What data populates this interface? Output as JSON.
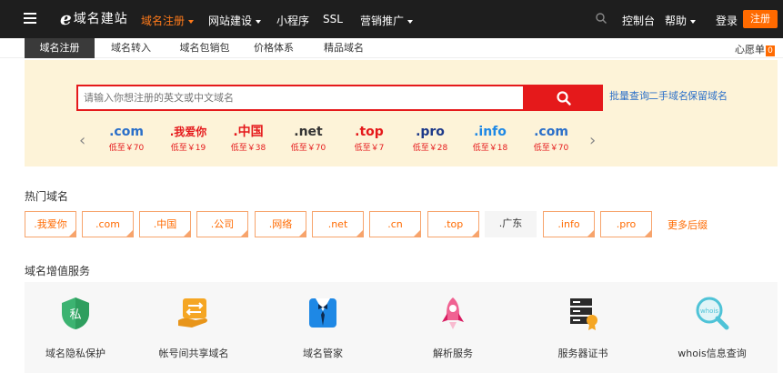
{
  "topnav": {
    "logo_text": "域名建站",
    "items": [
      {
        "label": "域名注册"
      },
      {
        "label": "网站建设"
      },
      {
        "label": "小程序"
      },
      {
        "label": "SSL"
      },
      {
        "label": "营销推广"
      }
    ],
    "console": "控制台",
    "help": "帮助",
    "login": "登录",
    "register": "注册",
    "colors": {
      "bg": "#1e1e1e",
      "accent": "#ff6a00",
      "active": "#ff7a1a"
    }
  },
  "subnav": {
    "tabs": [
      {
        "label": "域名注册"
      },
      {
        "label": "域名转入"
      },
      {
        "label": "域名包销包"
      },
      {
        "label": "价格体系"
      },
      {
        "label": "精品域名"
      }
    ],
    "wishlist": "心愿单",
    "wishlist_count": "0"
  },
  "hero": {
    "search_placeholder": "请输入你想注册的英文或中文域名",
    "links": [
      "批量查询",
      "二手域名",
      "保留域名"
    ],
    "tlds": [
      {
        "name": ".com",
        "price": "低至￥70",
        "color": "#2a6fc9"
      },
      {
        "name": ".我爱你",
        "price": "低至￥19",
        "color": "#e5191b"
      },
      {
        "name": ".中国",
        "price": "低至￥38",
        "color": "#e5191b"
      },
      {
        "name": ".net",
        "price": "低至￥70",
        "color": "#333333"
      },
      {
        "name": ".top",
        "price": "低至￥7",
        "color": "#e5191b"
      },
      {
        "name": ".pro",
        "price": "低至￥28",
        "color": "#1e3a8a"
      },
      {
        "name": ".info",
        "price": "低至￥18",
        "color": "#1e88e5"
      },
      {
        "name": ".com",
        "price": "低至￥70",
        "color": "#2a6fc9"
      }
    ]
  },
  "hot": {
    "title": "热门域名",
    "tags": [
      {
        "label": ".我爱你"
      },
      {
        "label": ".com"
      },
      {
        "label": ".中国"
      },
      {
        "label": ".公司"
      },
      {
        "label": ".网络"
      },
      {
        "label": ".net"
      },
      {
        "label": ".cn"
      },
      {
        "label": ".top"
      },
      {
        "label": ".广东"
      },
      {
        "label": ".info"
      },
      {
        "label": ".pro"
      }
    ],
    "more": "更多后缀"
  },
  "services": {
    "title": "域名增值服务",
    "items": [
      {
        "label": "域名隐私保护",
        "icon": "privacy-shield-icon",
        "icon_text": "私"
      },
      {
        "label": "帐号间共享域名",
        "icon": "share-hand-icon"
      },
      {
        "label": "域名管家",
        "icon": "butler-icon"
      },
      {
        "label": "解析服务",
        "icon": "rocket-icon"
      },
      {
        "label": "服务器证书",
        "icon": "server-certificate-icon"
      },
      {
        "label": "whois信息查询",
        "icon": "whois-search-icon",
        "icon_text": "whois"
      }
    ]
  }
}
